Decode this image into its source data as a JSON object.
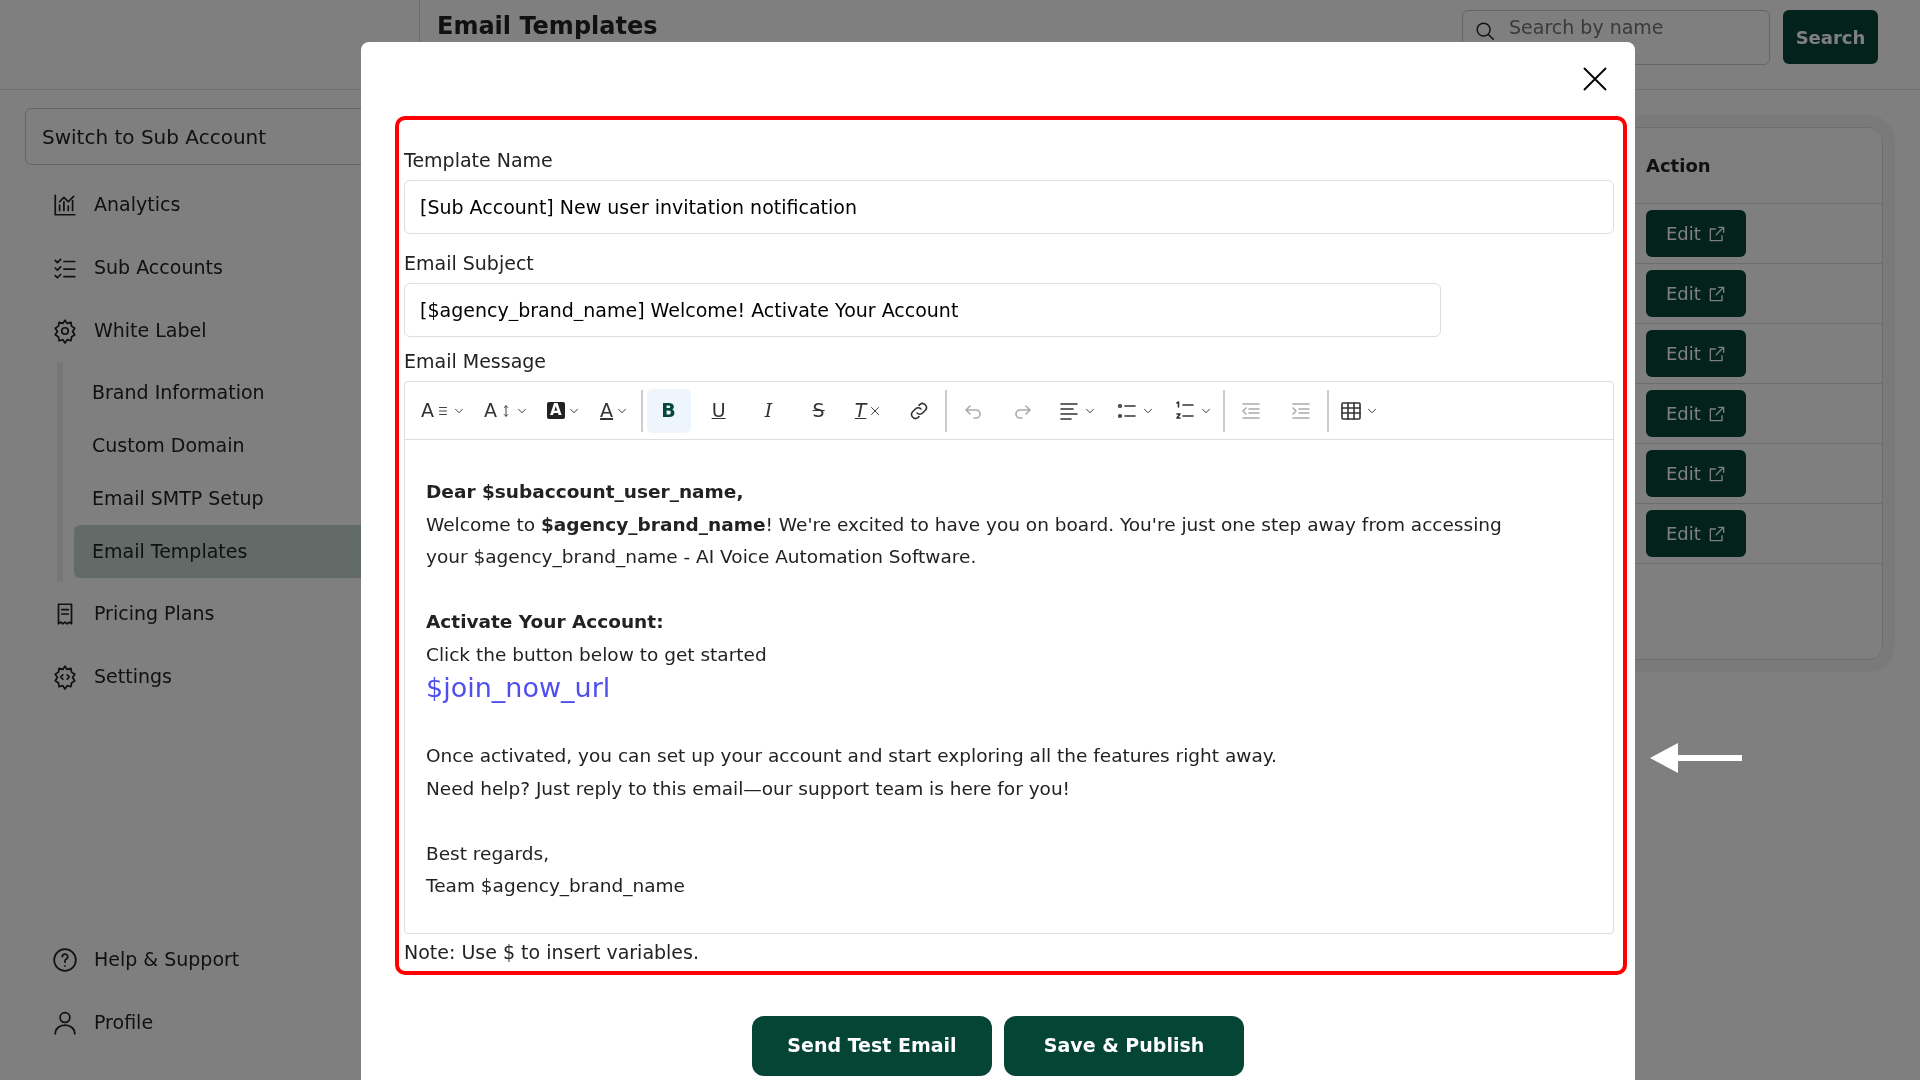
{
  "sidebar": {
    "account_switcher": "Switch to Sub Account",
    "items": [
      {
        "label": "Analytics",
        "selected": false
      },
      {
        "label": "Sub Accounts",
        "selected": false
      },
      {
        "label": "White Label",
        "selected": false,
        "children": [
          {
            "label": "Brand Information",
            "selected": false
          },
          {
            "label": "Custom Domain",
            "selected": false
          },
          {
            "label": "Email SMTP Setup",
            "selected": false
          },
          {
            "label": "Email Templates",
            "selected": true
          }
        ]
      },
      {
        "label": "Pricing Plans",
        "selected": false
      },
      {
        "label": "Settings",
        "selected": false
      }
    ],
    "footer_items": [
      {
        "label": "Help & Support"
      },
      {
        "label": "Profile"
      }
    ]
  },
  "page": {
    "title": "Email Templates",
    "search": {
      "placeholder": "Search by name"
    },
    "search_button": "Search"
  },
  "table": {
    "columns": [
      "Action"
    ],
    "rows": [
      {
        "action": "Edit"
      },
      {
        "action": "Edit"
      },
      {
        "action": "Edit"
      },
      {
        "action": "Edit"
      },
      {
        "action": "Edit"
      },
      {
        "action": "Edit"
      }
    ]
  },
  "modal": {
    "template_name": {
      "label": "Template Name",
      "value": "[Sub Account] New user invitation notification"
    },
    "email_subject": {
      "label": "Email Subject",
      "value": "[$agency_brand_name] Welcome! Activate Your Account"
    },
    "email_message": {
      "label": "Email Message",
      "toolbar": [
        [
          {
            "kind": "dropdown",
            "glyph": "A",
            "selected": false,
            "disabled": false
          },
          {
            "kind": "dropdown",
            "glyph": "A",
            "selected": false,
            "disabled": false
          },
          {
            "kind": "dropdown",
            "glyph": "A",
            "selected": false,
            "disabled": false
          },
          {
            "kind": "dropdown",
            "glyph": "A",
            "selected": false,
            "disabled": false
          }
        ],
        [
          {
            "kind": "button",
            "glyph": "B",
            "selected": true,
            "disabled": false
          },
          {
            "kind": "button",
            "glyph": "U",
            "selected": false,
            "disabled": false
          },
          {
            "kind": "button",
            "glyph": "I",
            "selected": false,
            "disabled": false
          },
          {
            "kind": "button",
            "glyph": "S",
            "selected": false,
            "disabled": false
          },
          {
            "kind": "button",
            "glyph": "T",
            "selected": false,
            "disabled": false
          },
          {
            "kind": "button",
            "selected": false,
            "disabled": false
          }
        ],
        [
          {
            "kind": "button",
            "selected": false,
            "disabled": true
          },
          {
            "kind": "button",
            "selected": false,
            "disabled": true
          },
          {
            "kind": "dropdown",
            "selected": false,
            "disabled": false
          },
          {
            "kind": "dropdown",
            "selected": false,
            "disabled": false
          },
          {
            "kind": "dropdown",
            "selected": false,
            "disabled": false
          }
        ],
        [
          {
            "kind": "button",
            "selected": false,
            "disabled": true
          },
          {
            "kind": "button",
            "selected": false,
            "disabled": true
          }
        ],
        [
          {
            "kind": "dropdown",
            "selected": false,
            "disabled": false
          }
        ]
      ],
      "blocks": [
        [
          {
            "kind": "bold",
            "text": "Dear $subaccount_user_name,"
          },
          {
            "kind": "text",
            "text": "Welcome to **$agency_brand_name**! We're excited to have you on board. You're just one step away from accessing your $agency_brand_name - AI Voice Automation Software."
          }
        ],
        [
          {
            "kind": "bold",
            "text": "Activate Your Account:"
          },
          {
            "kind": "text",
            "text": "Click the button below to get started"
          },
          {
            "kind": "link",
            "text": "$join_now_url"
          }
        ],
        [
          {
            "kind": "text",
            "text": "Once activated, you can set up your account and start exploring all the features right away."
          },
          {
            "kind": "text",
            "text": "Need help? Just reply to this email—our support team is here for you!"
          }
        ],
        [
          {
            "kind": "text",
            "text": "Best regards,"
          },
          {
            "kind": "text",
            "text": "Team $agency_brand_name"
          }
        ]
      ]
    },
    "note": "Note: Use $ to insert variables.",
    "buttons": [
      "Send Test Email",
      "Save & Publish"
    ]
  }
}
